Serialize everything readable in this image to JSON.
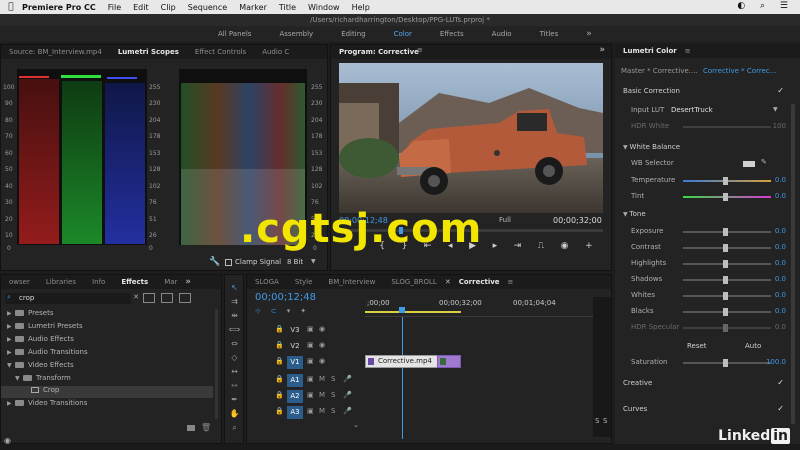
{
  "menubar": {
    "app": "Premiere Pro CC",
    "items": [
      "File",
      "Edit",
      "Clip",
      "Sequence",
      "Marker",
      "Title",
      "Window",
      "Help"
    ]
  },
  "window": {
    "path": "/Users/richardharrington/Desktop/PPG-LUTs.prproj *"
  },
  "workspaces": {
    "items": [
      "All Panels",
      "Assembly",
      "Editing",
      "Color",
      "Effects",
      "Audio",
      "Titles"
    ],
    "active": "Color"
  },
  "source_panel": {
    "tabs": [
      "Source: BM_Interview.mp4",
      "Lumetri Scopes",
      "Effect Controls",
      "Audio C"
    ],
    "active_tab": "Lumetri Scopes",
    "left_ticks": [
      "100",
      "90",
      "80",
      "70",
      "60",
      "50",
      "40",
      "30",
      "20",
      "10",
      "0"
    ],
    "right_ticks": [
      "255",
      "230",
      "204",
      "178",
      "153",
      "128",
      "102",
      "76",
      "51",
      "26",
      "0"
    ],
    "clamp_label": "Clamp Signal",
    "bit_depth": "8 Bit"
  },
  "program": {
    "title": "Program: Corrective",
    "timecode_left": "00;00;12;48",
    "timecode_right": "00;00;32;00",
    "fit": "Full"
  },
  "lumetri": {
    "title": "Lumetri Color",
    "master": "Master * Corrective....",
    "clip": "Corrective * Correc...",
    "basic": "Basic Correction",
    "input_lut_label": "Input LUT",
    "input_lut_value": "DesertTruck",
    "hdr_white_label": "HDR White",
    "hdr_white_value": "100",
    "white_balance": "White Balance",
    "wb_selector": "WB Selector",
    "temperature_label": "Temperature",
    "temperature_value": "0.0",
    "tint_label": "Tint",
    "tint_value": "0.0",
    "tone": "Tone",
    "tone_rows": [
      {
        "label": "Exposure",
        "value": "0.0"
      },
      {
        "label": "Contrast",
        "value": "0.0"
      },
      {
        "label": "Highlights",
        "value": "0.0"
      },
      {
        "label": "Shadows",
        "value": "0.0"
      },
      {
        "label": "Whites",
        "value": "0.0"
      },
      {
        "label": "Blacks",
        "value": "0.0"
      },
      {
        "label": "HDR Specular",
        "value": "0.0"
      }
    ],
    "reset": "Reset",
    "auto": "Auto",
    "saturation_label": "Saturation",
    "saturation_value": "100.0",
    "creative": "Creative",
    "curves": "Curves",
    "colors": {
      "accent": "#3f9ae8"
    }
  },
  "effects_panel": {
    "tabs": [
      "owser",
      "Libraries",
      "Info",
      "Effects",
      "Mar"
    ],
    "active_tab": "Effects",
    "search_value": "crop",
    "tree": [
      {
        "label": "Presets",
        "level": 0,
        "open": false
      },
      {
        "label": "Lumetri Presets",
        "level": 0,
        "open": false
      },
      {
        "label": "Audio Effects",
        "level": 0,
        "open": false
      },
      {
        "label": "Audio Transitions",
        "level": 0,
        "open": false
      },
      {
        "label": "Video Effects",
        "level": 0,
        "open": true
      },
      {
        "label": "Transform",
        "level": 1,
        "open": true
      },
      {
        "label": "Crop",
        "level": 2,
        "open": false
      },
      {
        "label": "Video Transitions",
        "level": 0,
        "open": false
      }
    ]
  },
  "timeline": {
    "tabs": [
      "SLOGA",
      "Style",
      "BM_Interview",
      "SLOG_BROLL",
      "Corrective"
    ],
    "active_tab": "Corrective",
    "timecode": "00;00;12;48",
    "ruler": [
      ";00;00",
      "00;00;32;00",
      "00;01;04;04"
    ],
    "tracks": [
      {
        "name": "V3",
        "type": "video",
        "selected": false
      },
      {
        "name": "V2",
        "type": "video",
        "selected": false
      },
      {
        "name": "V1",
        "type": "video",
        "selected": true
      },
      {
        "name": "A1",
        "type": "audio",
        "selected": true
      },
      {
        "name": "A2",
        "type": "audio",
        "selected": true
      },
      {
        "name": "A3",
        "type": "audio",
        "selected": true
      }
    ],
    "clip_label": "Corrective.mp4",
    "mute_label": "M",
    "solo_label": "S",
    "meter_labels": [
      "S",
      "S"
    ]
  },
  "watermark": ".cgtsj.com",
  "brand": {
    "name": "Linked",
    "suffix": "in"
  }
}
